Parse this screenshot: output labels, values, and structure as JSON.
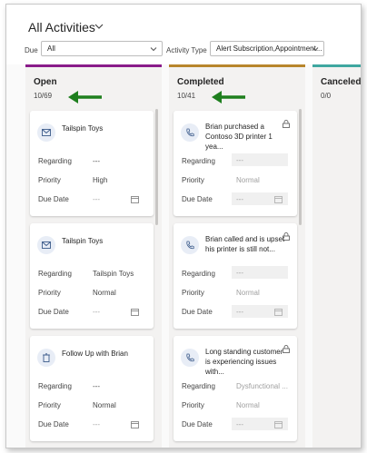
{
  "view": {
    "title": "All Activities"
  },
  "filters": {
    "due_label": "Due",
    "due_value": "All",
    "type_label": "Activity Type",
    "type_value": "Alert Subscription,Appointment..."
  },
  "columns": [
    {
      "title": "Open",
      "count": "10/69",
      "color": "#8a1c8a",
      "cards": [
        {
          "title": "Tailspin Toys",
          "icon": "email-icon",
          "locked": false,
          "regarding": "---",
          "priority": "High",
          "due": "---"
        },
        {
          "title": "Tailspin Toys",
          "icon": "email-icon",
          "locked": false,
          "regarding": "Tailspin Toys",
          "priority": "Normal",
          "due": "---"
        },
        {
          "title": "Follow Up with Brian",
          "icon": "task-icon",
          "locked": false,
          "regarding": "---",
          "priority": "Normal",
          "due": "---"
        }
      ]
    },
    {
      "title": "Completed",
      "count": "10/41",
      "color": "#b8862c",
      "cards": [
        {
          "title": "Brian purchased a Contoso 3D printer 1 yea...",
          "icon": "phone-icon",
          "locked": true,
          "regarding": "---",
          "priority": "Normal",
          "due": "---"
        },
        {
          "title": "Brian called and is upset his printer is still not...",
          "icon": "phone-icon",
          "locked": true,
          "regarding": "---",
          "priority": "Normal",
          "due": "---"
        },
        {
          "title": "Long standing customer is experiencing issues with...",
          "icon": "phone-icon",
          "locked": true,
          "regarding": "Dysfunctional ...",
          "priority": "Normal",
          "due": "---"
        }
      ]
    },
    {
      "title": "Canceled",
      "count": "0/0",
      "color": "#3fa7a0",
      "cards": []
    }
  ],
  "labels": {
    "regarding": "Regarding",
    "priority": "Priority",
    "due": "Due Date"
  },
  "colors": {
    "arrow": "#1e7f1e",
    "icon_bg": "#e8edf6",
    "icon_fg": "#3b5a8a"
  }
}
